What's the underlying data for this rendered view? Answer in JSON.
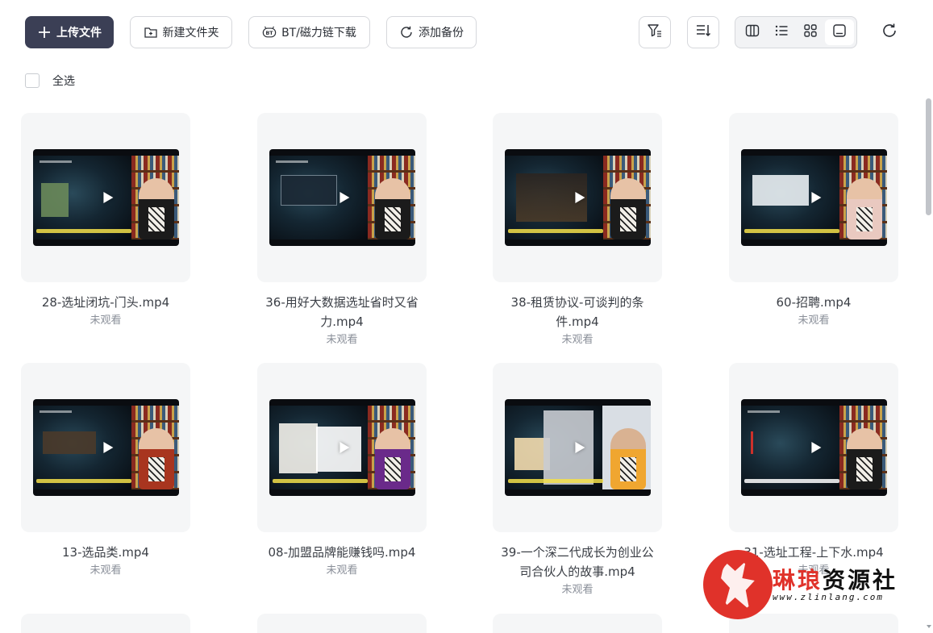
{
  "toolbar": {
    "upload_label": "上传文件",
    "new_folder_label": "新建文件夹",
    "bt_label": "BT/磁力链下载",
    "backup_label": "添加备份",
    "filter_icon": "filter-icon",
    "sort_icon": "sort-icon",
    "views": [
      {
        "icon": "columns-view-icon",
        "active": false
      },
      {
        "icon": "list-view-icon",
        "active": false
      },
      {
        "icon": "grid-view-icon",
        "active": false
      },
      {
        "icon": "thumbnail-view-icon",
        "active": true
      }
    ],
    "refresh_icon": "refresh-icon"
  },
  "select_all_label": "全选",
  "files": [
    {
      "name": "28-选址闭坑-门头.mp4",
      "status": "未观看"
    },
    {
      "name": "36-用好大数据选址省时又省力.mp4",
      "status": "未观看"
    },
    {
      "name": "38-租赁协议-可谈判的条件.mp4",
      "status": "未观看"
    },
    {
      "name": "60-招聘.mp4",
      "status": "未观看"
    },
    {
      "name": "13-选品类.mp4",
      "status": "未观看"
    },
    {
      "name": "08-加盟品牌能赚钱吗.mp4",
      "status": "未观看"
    },
    {
      "name": "39-一个深二代成长为创业公司合伙人的故事.mp4",
      "status": "未观看"
    },
    {
      "name": "31-选址工程-上下水.mp4",
      "status": "未观看"
    }
  ],
  "watermark": {
    "brand_red": "琳琅",
    "brand_dark": "资源社",
    "url": "www.zlinlang.com",
    "color": "#e0322a"
  },
  "colors": {
    "primary": "#3b3f55",
    "card_bg": "#f5f6f7",
    "muted_text": "#8a8f99"
  }
}
